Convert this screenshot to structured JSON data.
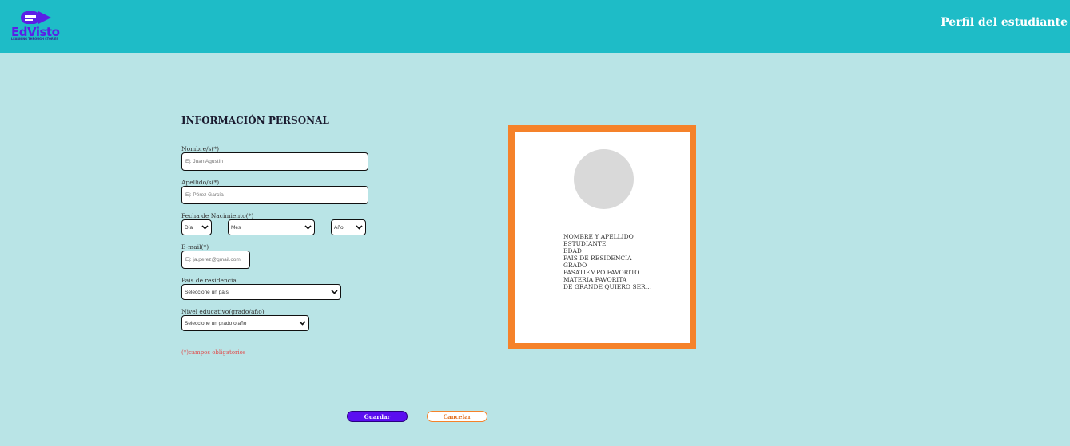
{
  "header": {
    "logo_text": "EdVisto",
    "logo_tagline": "LEARNING THROUGH STORIES",
    "title": "Perfil del estudiante"
  },
  "form": {
    "title": "INFORMACIÓN PERSONAL",
    "nombre_label": "Nombre/s(*)",
    "nombre_placeholder": "Ej: Juan Agustín",
    "apellido_label": "Apellido/s(*)",
    "apellido_placeholder": "Ej: Pérez García",
    "fecha_label": "Fecha de Nacimiento(*)",
    "dia_value": "Día",
    "mes_value": "Mes",
    "anio_value": "Año",
    "email_label": "E-mail(*)",
    "email_placeholder": "Ej: ja.perez@gmail.com",
    "pais_label": "País de residencia",
    "pais_value": "Seleccione un país",
    "nivel_label": "Nivel educativo(grado/año)",
    "nivel_value": "Seleccione un grado o año",
    "required_note": "(*)campos obligatorios"
  },
  "card": {
    "lines": [
      "NOMBRE Y APELLIDO",
      "ESTUDIANTE",
      "EDAD",
      "PAÍS DE RESIDENCIA",
      "GRADO",
      "PASATIEMPO FAVORITO",
      "MATERIA FAVORITA",
      "DE GRANDE QUIERO SER..."
    ]
  },
  "buttons": {
    "save_label": "Guardar",
    "cancel_label": "Cancelar"
  },
  "colors": {
    "header_bg": "#1ebcc7",
    "page_bg": "#b9e4e6",
    "card_border": "#f5822a",
    "primary": "#5a0ff0"
  }
}
